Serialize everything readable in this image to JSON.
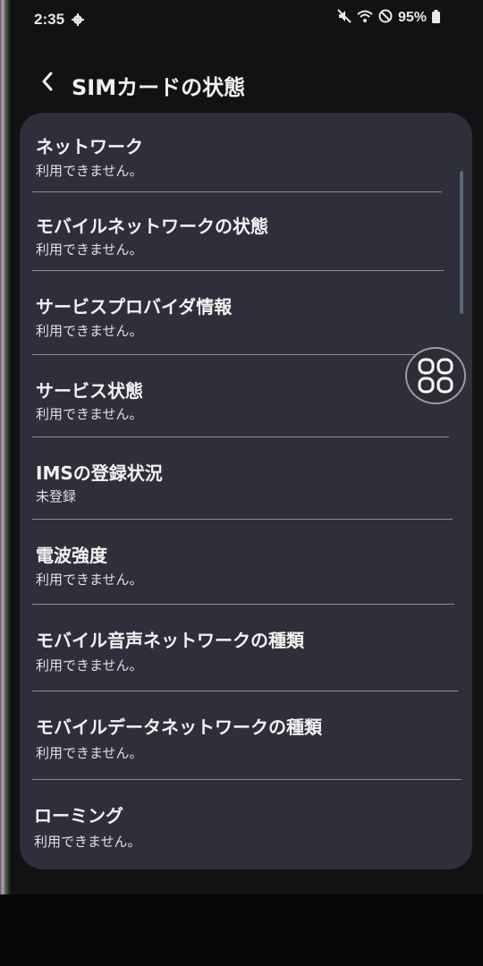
{
  "status_bar": {
    "time": "2:35",
    "battery_percent": "95%",
    "icons": [
      "gear-icon",
      "mute-icon",
      "wifi-icon",
      "do-not-disturb-icon",
      "battery-icon"
    ]
  },
  "header": {
    "back_icon": "chevron-left-icon",
    "title": "SIMカードの状態"
  },
  "items": [
    {
      "title": "ネットワーク",
      "value": "利用できません。"
    },
    {
      "title": "モバイルネットワークの状態",
      "value": "利用できません。"
    },
    {
      "title": "サービスプロバイダ情報",
      "value": "利用できません。"
    },
    {
      "title": "サービス状態",
      "value": "利用できません。"
    },
    {
      "title": "IMSの登録状況",
      "value": "未登録"
    },
    {
      "title": "電波強度",
      "value": "利用できません。"
    },
    {
      "title": "モバイル音声ネットワークの種類",
      "value": "利用できません。"
    },
    {
      "title": "モバイルデータネットワークの種類",
      "value": "利用できません。"
    },
    {
      "title": "ローミング",
      "value": "利用できません。"
    }
  ],
  "floating_button": {
    "icon": "apps-grid-icon"
  },
  "colors": {
    "background": "#121214",
    "card": "#2e2f3a",
    "text_primary": "#f2f2f2",
    "divider": "#8a8b94"
  }
}
